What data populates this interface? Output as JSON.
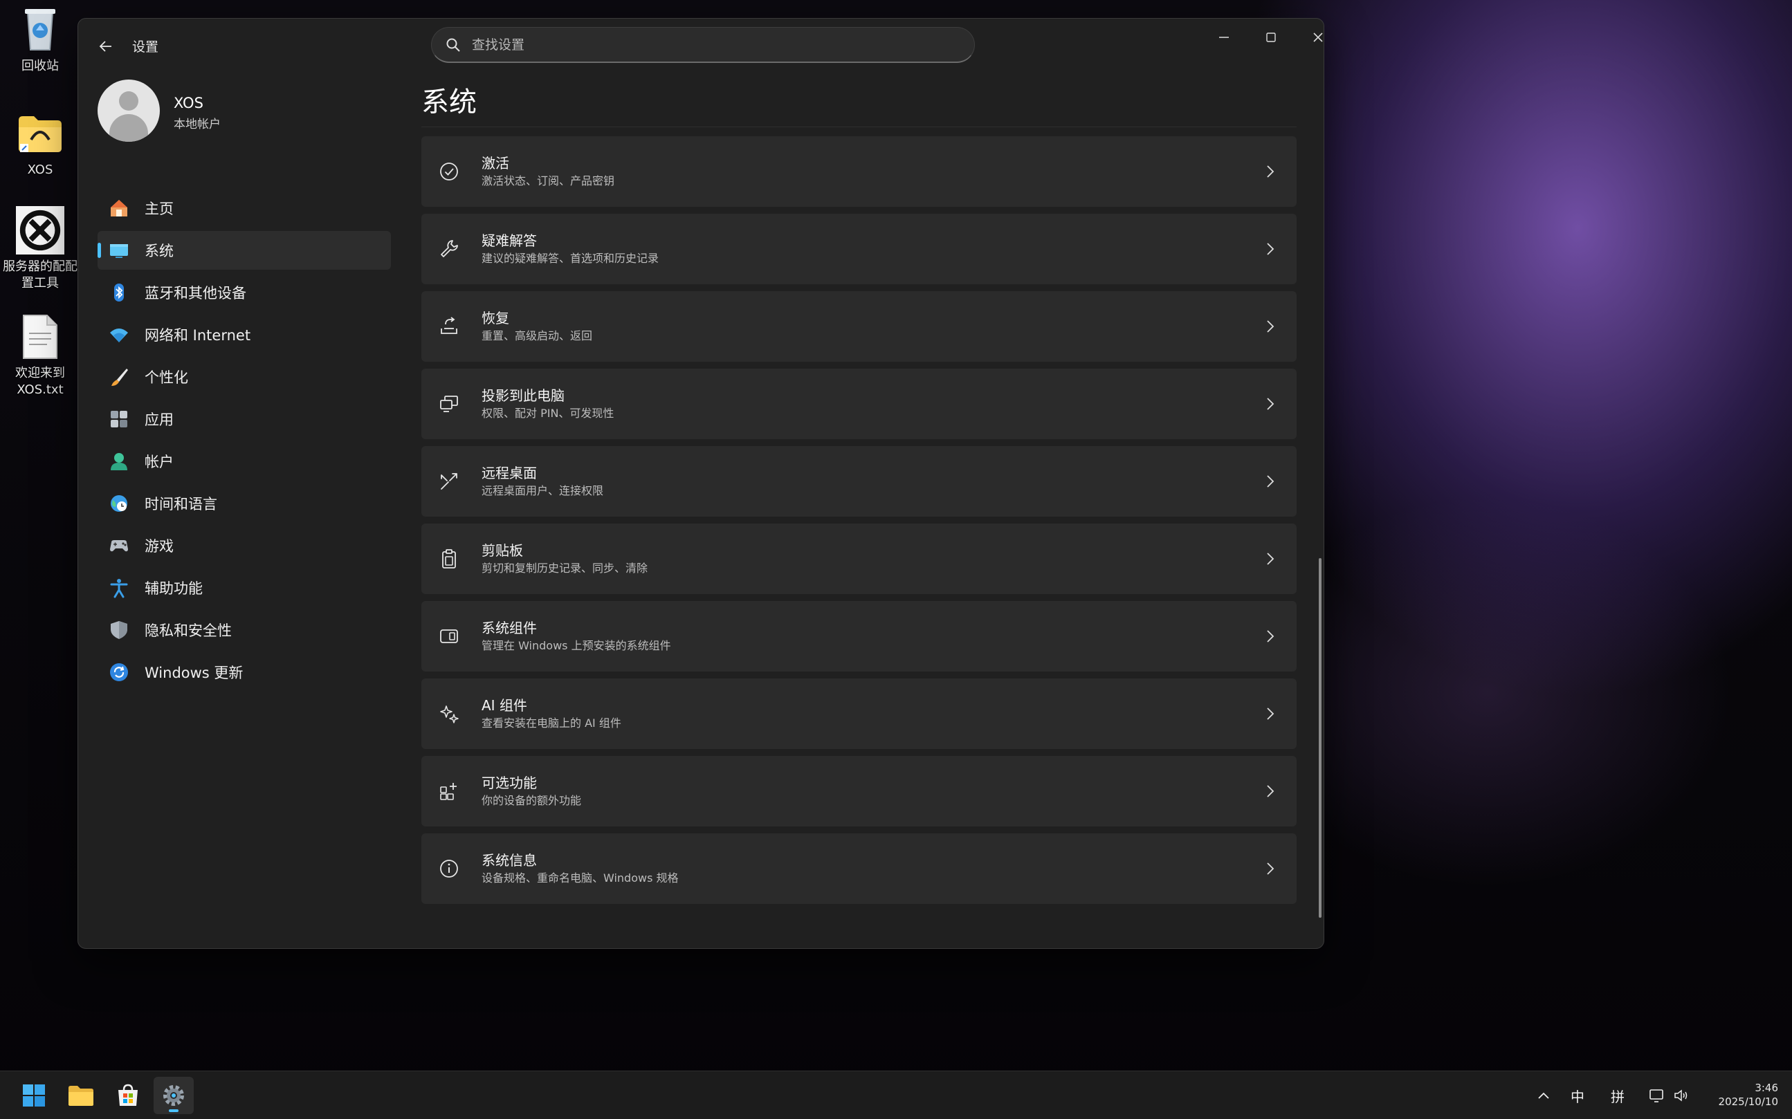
{
  "desktop": {
    "icons": [
      {
        "label": "回收站",
        "icon": "recycle-bin-icon"
      },
      {
        "label": "XOS",
        "icon": "folder-icon"
      },
      {
        "label": "服务器的配配置工具",
        "icon": "tool-icon"
      },
      {
        "label": "欢迎来到XOS.txt",
        "icon": "text-file-icon"
      }
    ]
  },
  "window": {
    "app_title": "设置",
    "search_placeholder": "查找设置"
  },
  "profile": {
    "name": "XOS",
    "subtitle": "本地帐户"
  },
  "sidebar": {
    "items": [
      {
        "label": "主页",
        "icon": "home-icon"
      },
      {
        "label": "系统",
        "icon": "system-monitor-icon",
        "active": true
      },
      {
        "label": "蓝牙和其他设备",
        "icon": "bluetooth-icon"
      },
      {
        "label": "网络和 Internet",
        "icon": "wifi-icon"
      },
      {
        "label": "个性化",
        "icon": "brush-icon"
      },
      {
        "label": "应用",
        "icon": "apps-icon"
      },
      {
        "label": "帐户",
        "icon": "account-icon"
      },
      {
        "label": "时间和语言",
        "icon": "globe-clock-icon"
      },
      {
        "label": "游戏",
        "icon": "gamepad-icon"
      },
      {
        "label": "辅助功能",
        "icon": "accessibility-icon"
      },
      {
        "label": "隐私和安全性",
        "icon": "shield-icon"
      },
      {
        "label": "Windows 更新",
        "icon": "windows-update-icon"
      }
    ]
  },
  "main": {
    "title": "系统",
    "cards": [
      {
        "title": "激活",
        "desc": "激活状态、订阅、产品密钥",
        "icon": "check-circle-icon"
      },
      {
        "title": "疑难解答",
        "desc": "建议的疑难解答、首选项和历史记录",
        "icon": "wrench-icon"
      },
      {
        "title": "恢复",
        "desc": "重置、高级启动、返回",
        "icon": "recovery-icon"
      },
      {
        "title": "投影到此电脑",
        "desc": "权限、配对 PIN、可发现性",
        "icon": "project-icon"
      },
      {
        "title": "远程桌面",
        "desc": "远程桌面用户、连接权限",
        "icon": "remote-desktop-icon"
      },
      {
        "title": "剪贴板",
        "desc": "剪切和复制历史记录、同步、清除",
        "icon": "clipboard-icon"
      },
      {
        "title": "系统组件",
        "desc": "管理在 Windows 上预安装的系统组件",
        "icon": "system-components-icon"
      },
      {
        "title": "AI 组件",
        "desc": "查看安装在电脑上的 AI 组件",
        "icon": "sparkle-icon"
      },
      {
        "title": "可选功能",
        "desc": "你的设备的额外功能",
        "icon": "optional-features-icon"
      },
      {
        "title": "系统信息",
        "desc": "设备规格、重命名电脑、Windows 规格",
        "icon": "info-icon"
      }
    ]
  },
  "taskbar": {
    "apps": [
      {
        "name": "start",
        "icon": "windows-start-icon"
      },
      {
        "name": "file-explorer",
        "icon": "folder-icon"
      },
      {
        "name": "store",
        "icon": "store-icon"
      },
      {
        "name": "settings",
        "icon": "gear-icon",
        "active": true
      }
    ],
    "tray": {
      "chevron": "^",
      "lang": "中",
      "ime": "拼",
      "clock_time": "3:46",
      "clock_date": "2025/10/10"
    }
  },
  "colors": {
    "accent": "#4cc2ff",
    "window_bg": "#202020",
    "card_bg": "#2b2b2b"
  }
}
